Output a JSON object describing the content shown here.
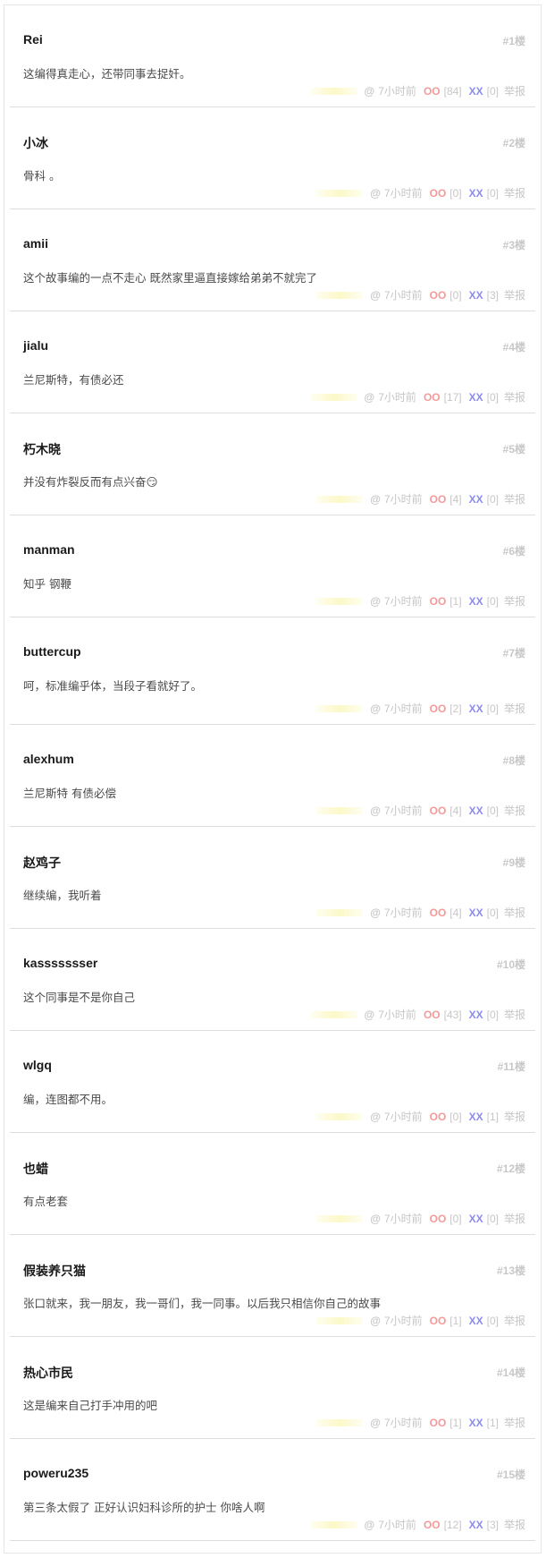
{
  "labels": {
    "at": "@",
    "oo": "OO",
    "xx": "XX",
    "report": "举报"
  },
  "comments": [
    {
      "author": "Rei",
      "floor": "#1楼",
      "text": "这编得真走心，还带同事去捉奸。",
      "time": "7小时前",
      "oo": "[84]",
      "xx": "[0]"
    },
    {
      "author": "小冰",
      "floor": "#2楼",
      "text": "骨科 。",
      "time": "7小时前",
      "oo": "[0]",
      "xx": "[0]"
    },
    {
      "author": "amii",
      "floor": "#3楼",
      "text": "这个故事编的一点不走心 既然家里逼直接嫁给弟弟不就完了",
      "time": "7小时前",
      "oo": "[0]",
      "xx": "[3]"
    },
    {
      "author": "jialu",
      "floor": "#4楼",
      "text": "兰尼斯特，有债必还",
      "time": "7小时前",
      "oo": "[17]",
      "xx": "[0]"
    },
    {
      "author": "朽木晓",
      "floor": "#5楼",
      "text": "并没有炸裂反而有点兴奋😏",
      "time": "7小时前",
      "oo": "[4]",
      "xx": "[0]"
    },
    {
      "author": "manman",
      "floor": "#6楼",
      "text": "知乎 钢鞭",
      "time": "7小时前",
      "oo": "[1]",
      "xx": "[0]"
    },
    {
      "author": "buttercup",
      "floor": "#7楼",
      "text": "呵，标准编乎体，当段子看就好了。",
      "time": "7小时前",
      "oo": "[2]",
      "xx": "[0]"
    },
    {
      "author": "alexhum",
      "floor": "#8楼",
      "text": "兰尼斯特 有债必偿",
      "time": "7小时前",
      "oo": "[4]",
      "xx": "[0]"
    },
    {
      "author": "赵鸡子",
      "floor": "#9楼",
      "text": "继续编，我听着",
      "time": "7小时前",
      "oo": "[4]",
      "xx": "[0]"
    },
    {
      "author": "kassssssser",
      "floor": "#10楼",
      "text": "这个同事是不是你自己",
      "time": "7小时前",
      "oo": "[43]",
      "xx": "[0]"
    },
    {
      "author": "wlgq",
      "floor": "#11楼",
      "text": "编，连图都不用。",
      "time": "7小时前",
      "oo": "[0]",
      "xx": "[1]"
    },
    {
      "author": "也蜡",
      "floor": "#12楼",
      "text": "有点老套",
      "time": "7小时前",
      "oo": "[0]",
      "xx": "[0]"
    },
    {
      "author": "假装养只猫",
      "floor": "#13楼",
      "text": "张口就来，我一朋友，我一哥们，我一同事。以后我只相信你自己的故事",
      "time": "7小时前",
      "oo": "[1]",
      "xx": "[0]"
    },
    {
      "author": "热心市民",
      "floor": "#14楼",
      "text": "这是编来自己打手冲用的吧",
      "time": "7小时前",
      "oo": "[1]",
      "xx": "[1]"
    },
    {
      "author": "poweru235",
      "floor": "#15楼",
      "text": "第三条太假了 正好认识妇科诊所的护士 你啥人啊",
      "time": "7小时前",
      "oo": "[12]",
      "xx": "[3]"
    }
  ]
}
